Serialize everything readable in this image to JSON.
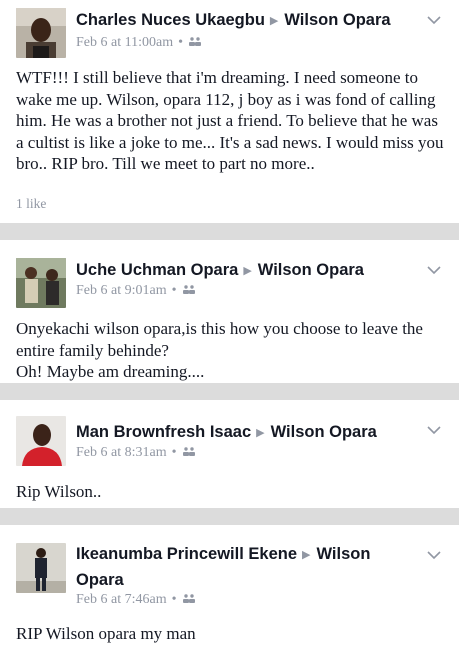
{
  "comments": [
    {
      "author": "Charles Nuces Ukaegbu",
      "target": "Wilson Opara",
      "time": "Feb 6 at 11:00am",
      "text": "WTF!!!  I still believe that i'm dreaming.  I need someone to wake me up.  Wilson, opara 112, j boy as i was fond of calling him. He was a brother not just a friend. To believe that he was a cultist is like a joke to me...  It's a sad news. I would miss you bro.. RIP bro.   Till we meet to part no more..",
      "likes": "1 like"
    },
    {
      "author": "Uche Uchman Opara",
      "target": "Wilson Opara",
      "time": "Feb 6 at 9:01am",
      "text": "Onyekachi wilson opara,is this how you choose to leave the entire family behinde?\nOh! Maybe am dreaming...."
    },
    {
      "author": "Man Brownfresh Isaac",
      "target": "Wilson Opara",
      "time": "Feb 6 at 8:31am",
      "text": "Rip Wilson.."
    },
    {
      "author": "Ikeanumba Princewill Ekene",
      "target": "Wilson Opara",
      "time": "Feb 6 at 7:46am",
      "text": "RIP Wilson opara my man"
    }
  ],
  "colors": {
    "background": "#ffffff",
    "separator": "#dcdcdc",
    "meta": "#9197a3",
    "text": "#141823"
  },
  "icons": {
    "audience": "friends-audience-icon",
    "menu": "chevron-down-icon",
    "arrow": "triangle-right-icon"
  }
}
